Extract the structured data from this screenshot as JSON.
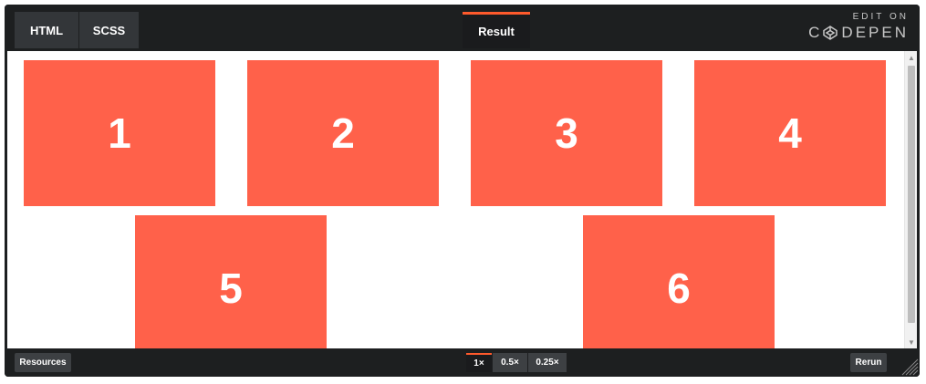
{
  "editor_tabs": {
    "html": "HTML",
    "scss": "SCSS",
    "result": "Result"
  },
  "branding": {
    "edit_on": "EDIT ON",
    "codepen": "DEPEN"
  },
  "result_boxes": [
    "1",
    "2",
    "3",
    "4",
    "5",
    "6"
  ],
  "bottom_bar": {
    "resources": "Resources",
    "zoom_1x": "1×",
    "zoom_05x": "0.5×",
    "zoom_025x": "0.25×",
    "rerun": "Rerun"
  },
  "colors": {
    "box": "#ff614a",
    "accent": "#ff5a2c",
    "chrome": "#1d1f20"
  },
  "icons": {
    "codepen_logo": "codepen-logo-icon",
    "scroll_up": "scroll-up-arrow-icon",
    "scroll_down": "scroll-down-arrow-icon",
    "resize": "resize-handle-icon"
  }
}
